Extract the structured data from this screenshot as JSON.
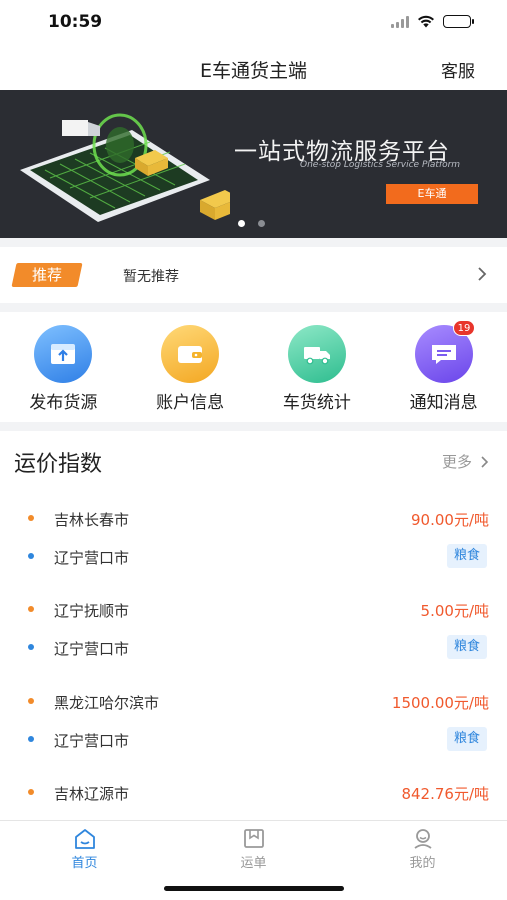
{
  "status": {
    "time": "10:59"
  },
  "nav": {
    "title": "E车通货主端",
    "service": "客服"
  },
  "banner": {
    "title": "一站式物流服务平台",
    "subtitle": "One-stop Logistics Service Platform",
    "button": "E车通",
    "slide_count": 2,
    "active_slide": 1
  },
  "recommend": {
    "tag": "推荐",
    "text": "暂无推荐"
  },
  "quick_actions": [
    {
      "label": "发布货源",
      "icon": "publish-icon",
      "color": "#3d8ef0"
    },
    {
      "label": "账户信息",
      "icon": "wallet-icon",
      "color": "#f5b32b"
    },
    {
      "label": "车货统计",
      "icon": "truck-icon",
      "color": "#3ec9a0"
    },
    {
      "label": "通知消息",
      "icon": "message-icon",
      "color": "#7b5cf0",
      "badge": "19"
    }
  ],
  "freight": {
    "title": "运价指数",
    "more": "更多",
    "routes": [
      {
        "from": "吉林长春市",
        "to": "辽宁营口市",
        "price": "90.00元/吨",
        "cargo": "粮食"
      },
      {
        "from": "辽宁抚顺市",
        "to": "辽宁营口市",
        "price": "5.00元/吨",
        "cargo": "粮食"
      },
      {
        "from": "黑龙江哈尔滨市",
        "to": "辽宁营口市",
        "price": "1500.00元/吨",
        "cargo": "粮食"
      },
      {
        "from": "吉林辽源市",
        "to": "",
        "price": "842.76元/吨",
        "cargo": ""
      }
    ]
  },
  "tabs": [
    {
      "label": "首页",
      "icon": "home-icon",
      "active": true
    },
    {
      "label": "运单",
      "icon": "waybill-icon",
      "active": false
    },
    {
      "label": "我的",
      "icon": "profile-icon",
      "active": false
    }
  ],
  "colors": {
    "accent": "#2f86dd",
    "price": "#f0592d",
    "origin_dot": "#f28b2a",
    "dest_dot": "#2f86dd"
  }
}
